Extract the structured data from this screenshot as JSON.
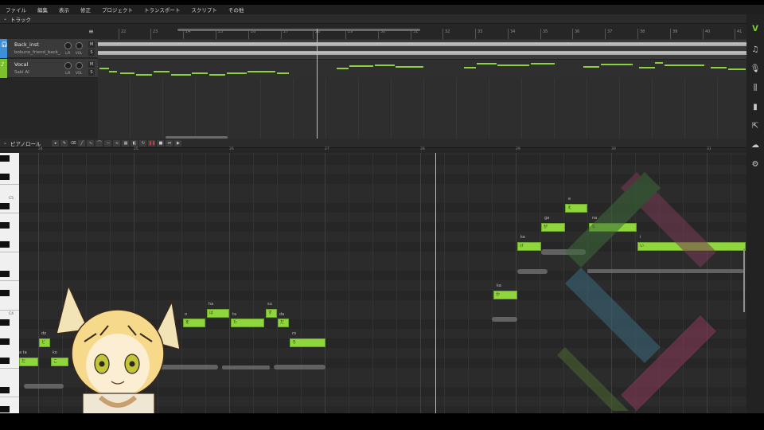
{
  "menu": [
    "ファイル",
    "編集",
    "表示",
    "修正",
    "プロジェクト",
    "トランスポート",
    "スクリプト",
    "その他"
  ],
  "track_section": {
    "chevron": "⌄",
    "title": "トラック"
  },
  "tracks": [
    {
      "name": "Back_inst",
      "sub": "bokuno_friend_back_...",
      "color": "#3c8fd8",
      "mute": "M",
      "solo": "S"
    },
    {
      "name": "Vocal",
      "sub": "Saki AI",
      "color": "#7cc12c",
      "mute": "M",
      "solo": "S"
    }
  ],
  "knob_labels": [
    "L/R",
    "VOL"
  ],
  "arr_ruler": [
    "22",
    "23",
    "24",
    "25",
    "26",
    "27",
    "28",
    "29",
    "30",
    "31",
    "32",
    "33",
    "34",
    "35",
    "36",
    "37",
    "38",
    "39",
    "40",
    "41"
  ],
  "pianoroll": {
    "chevron": "⌄",
    "title": "ピアノロール",
    "ruler": [
      "24",
      "25",
      "26",
      "27",
      "28",
      "29",
      "30",
      "31"
    ],
    "octaves": [
      "C5",
      "C4"
    ],
    "notes_left": [
      {
        "lyric": "だ",
        "above": "a ta"
      },
      {
        "lyric": "こ",
        "above": "ko"
      },
      {
        "lyric": "ど",
        "above": "do"
      },
      {
        "lyric": "を",
        "above": "o"
      },
      {
        "lyric": "は",
        "above": "ha"
      },
      {
        "lyric": "た",
        "above": "ta"
      },
      {
        "lyric": "す",
        "above": "su"
      },
      {
        "lyric": "だ",
        "above": "da"
      },
      {
        "lyric": "ろ",
        "above": "ro"
      }
    ],
    "notes_right": [
      {
        "lyric": "か",
        "above": "ka"
      },
      {
        "lyric": "け",
        "above": "ke"
      },
      {
        "lyric": "が",
        "above": "ga"
      },
      {
        "lyric": "え",
        "above": "e"
      },
      {
        "lyric": "な",
        "above": "na"
      },
      {
        "lyric": "い",
        "above": "i"
      }
    ]
  }
}
